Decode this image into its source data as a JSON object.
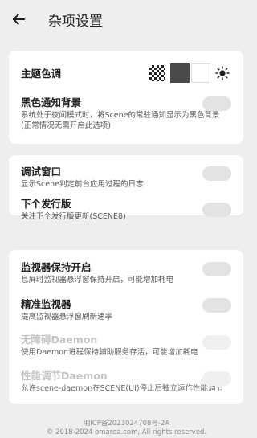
{
  "header": {
    "title": "杂项设置",
    "back_icon": "arrow-left-icon"
  },
  "card1": {
    "theme": {
      "label": "主题色调",
      "options": [
        "checker-pattern",
        "dark",
        "light"
      ],
      "sun_icon": "sun-icon"
    },
    "black_notification": {
      "title": "黑色通知背景",
      "desc_line1": "系统处于夜间模式时，将Scene的常驻通知显示为黑色背景",
      "desc_line2": "(正常情况无需开启此选项)",
      "enabled": false
    }
  },
  "card2": {
    "debug_window": {
      "title": "调试窗口",
      "desc": "显示Scene判定前台应用过程的日志",
      "enabled": false
    },
    "next_release": {
      "title": "下个发行版",
      "desc": "关注下个发行版更新(SCENE8)",
      "enabled": false
    }
  },
  "card3": {
    "monitor_keep_on": {
      "title": "监视器保持开启",
      "desc": "息屏时监视器悬浮窗保持开启，可能增加耗电",
      "enabled": false
    },
    "precise_monitor": {
      "title": "精准监视器",
      "desc": "提高监视器悬浮窗刷新速率",
      "enabled": false
    },
    "accessibility_daemon": {
      "title": "无障碍Daemon",
      "desc": "使用Daemon进程保持辅助服务存活，可能增加耗电",
      "enabled": false,
      "disabled": true
    },
    "perf_daemon": {
      "title": "性能调节Daemon",
      "desc": "允许scene-daemon在SCENE(UI)停止后独立运作性能调节",
      "enabled": false,
      "disabled": true
    }
  },
  "footer": {
    "icp": "湘ICP备2023024708号-2A",
    "copyright": "© 2018-2024 omarea.com, All rights reserved."
  },
  "colors": {
    "background": "#eeeeee",
    "card": "#ffffff",
    "toggle_off": "#e3e3e3",
    "disabled_text": "#c4c4c4"
  }
}
